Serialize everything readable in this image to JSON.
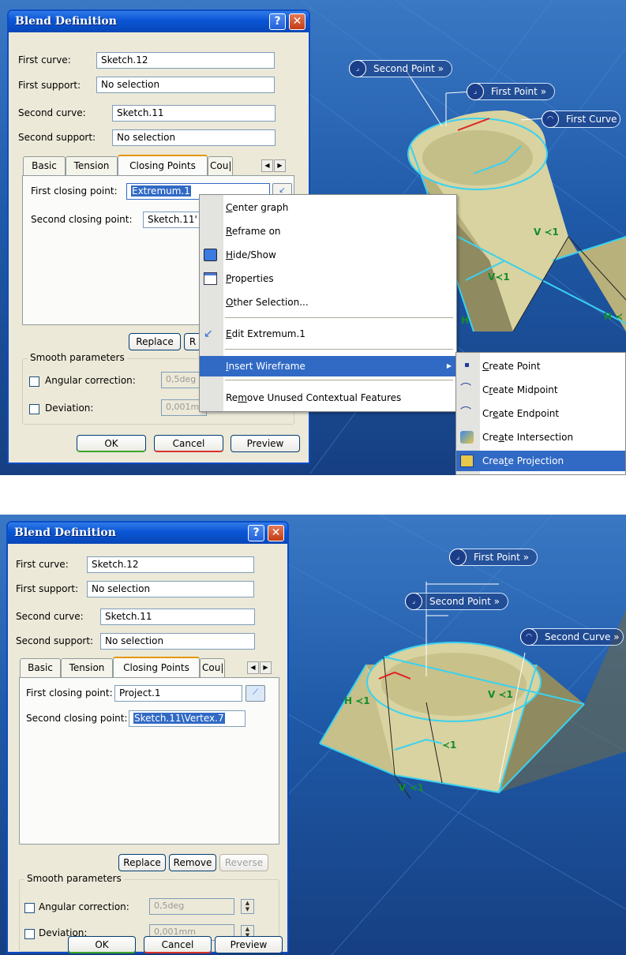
{
  "top": {
    "dialog": {
      "title": "Blend Definition",
      "help": "?",
      "close": "✕",
      "first_curve_label": "First curve:",
      "first_curve_value": "Sketch.12",
      "first_support_label": "First support:",
      "first_support_value": "No selection",
      "second_curve_label": "Second curve:",
      "second_curve_value": "Sketch.11",
      "second_support_label": "Second support:",
      "second_support_value": "No selection",
      "tabs": [
        "Basic",
        "Tension",
        "Closing Points",
        "Cou|"
      ],
      "first_closing_label": "First closing point:",
      "first_closing_value": "Extremum.1",
      "second_closing_label": "Second closing point:",
      "second_closing_value": "Sketch.11'",
      "replace": "Replace",
      "remove_partial": "R",
      "smooth_label": "Smooth parameters",
      "angular_label": "Angular correction:",
      "angular_value": "0,5deg",
      "deviation_label": "Deviation:",
      "deviation_value": "0,001m",
      "ok": "OK",
      "cancel": "Cancel",
      "preview": "Preview"
    },
    "context_menu": {
      "items": [
        {
          "key": "C",
          "rest": "enter graph"
        },
        {
          "key": "R",
          "rest": "eframe on"
        },
        {
          "key": "H",
          "rest": "ide/Show"
        },
        {
          "key": "P",
          "rest": "roperties"
        },
        {
          "pre": "",
          "key": "O",
          "rest": "ther Selection..."
        },
        {
          "key": "E",
          "rest": "dit Extremum.1"
        },
        {
          "key": "I",
          "rest": "nsert Wireframe"
        },
        {
          "pre": "Re",
          "key": "m",
          "rest": "ove Unused Contextual Features"
        }
      ]
    },
    "submenu": {
      "items": [
        {
          "pre": "",
          "key": "C",
          "rest": "reate Point"
        },
        {
          "pre": "C",
          "key": "r",
          "rest": "eate Midpoint"
        },
        {
          "pre": "Cr",
          "key": "e",
          "rest": "ate Endpoint"
        },
        {
          "pre": "Cre",
          "key": "a",
          "rest": "te Intersection"
        },
        {
          "pre": "Crea",
          "key": "t",
          "rest": "e Projection"
        }
      ]
    },
    "tags": {
      "second_point": "Second Point",
      "first_point": "First Point",
      "first_curve": "First Curve",
      "more": "»"
    }
  },
  "bottom": {
    "dialog": {
      "title": "Blend Definition",
      "help": "?",
      "close": "✕",
      "first_curve_label": "First curve:",
      "first_curve_value": "Sketch.12",
      "first_support_label": "First support:",
      "first_support_value": "No selection",
      "second_curve_label": "Second curve:",
      "second_curve_value": "Sketch.11",
      "second_support_label": "Second support:",
      "second_support_value": "No selection",
      "tabs": [
        "Basic",
        "Tension",
        "Closing Points",
        "Cou|"
      ],
      "first_closing_label": "First closing point:",
      "first_closing_value": "Project.1",
      "second_closing_label": "Second closing point:",
      "second_closing_value": "Sketch.11\\Vertex.7",
      "replace": "Replace",
      "remove": "Remove",
      "reverse": "Reverse",
      "smooth_label": "Smooth parameters",
      "angular_label": "Angular correction:",
      "angular_value": "0,5deg",
      "deviation_label": "Deviation:",
      "deviation_value": "0,001mm",
      "ok": "OK",
      "cancel": "Cancel",
      "preview": "Preview"
    },
    "tags": {
      "first_point": "First Point",
      "second_point": "Second Point",
      "second_curve": "Second Curve",
      "more": "»"
    }
  },
  "colors": {
    "viewport": "#1f5aa8",
    "surface": "#d8d3a0",
    "highlight": "#3ad2f0",
    "menu_highlight": "#316ac5"
  }
}
